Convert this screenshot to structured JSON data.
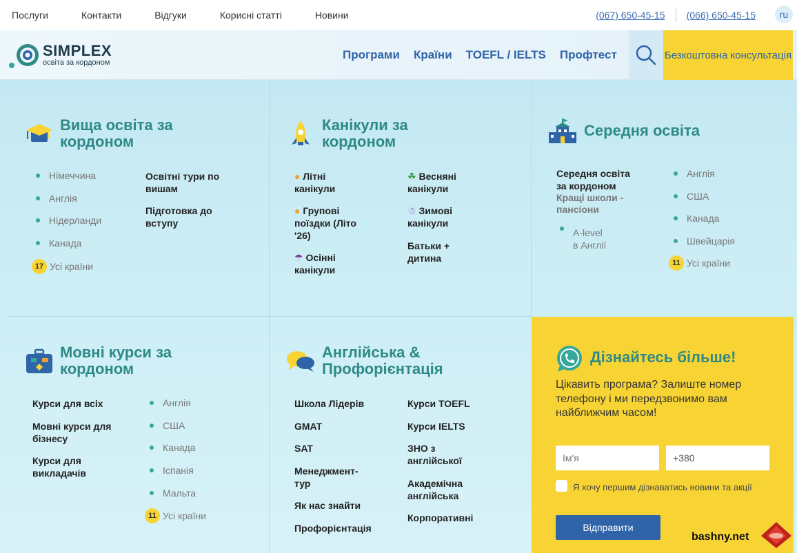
{
  "topbar": {
    "nav": [
      "Послуги",
      "Контакти",
      "Відгуки",
      "Корисні статті",
      "Новини"
    ],
    "phone1": "(067) 650-45-15",
    "phone2": "(066) 650-45-15",
    "lang": "ru"
  },
  "header": {
    "logo_title": "SIMPLEX",
    "logo_sub": "освіта за кордоном",
    "nav": [
      "Програми",
      "Країни",
      "TOEFL / IELTS",
      "Профтест"
    ],
    "consult": "Безкоштовна консультація"
  },
  "higher": {
    "title_line1": "Вища освіта за",
    "title_line2": "кордоном",
    "countries": [
      "Німеччина",
      "Англія",
      "Нідерланди",
      "Канада"
    ],
    "all_count": "17",
    "all_label": "Усі країни",
    "links": [
      {
        "l1": "Освітні тури по",
        "l2": "вишам"
      },
      {
        "l1": "Підготовка до",
        "l2": "вступу"
      }
    ]
  },
  "holidays": {
    "title_line1": "Канікули за",
    "title_line2": "кордоном",
    "left": [
      {
        "icon": "🟠",
        "l1": "Літні",
        "l2": "канікули",
        "l3": ""
      },
      {
        "icon": "🟠",
        "l1": "Групові",
        "l2": "поїздки (Літо",
        "l3": "'26)"
      },
      {
        "icon": "☂",
        "l1": "Осінні",
        "l2": "канікули",
        "l3": ""
      }
    ],
    "right": [
      {
        "icon": "☘",
        "l1": "Весняні",
        "l2": "канікули"
      },
      {
        "icon": "☃",
        "l1": "Зимові",
        "l2": "канікули"
      },
      {
        "icon": "",
        "l1": "Батьки +",
        "l2": "дитина"
      }
    ]
  },
  "secondary": {
    "title": "Середня освіта",
    "main_l1": "Середня освіта",
    "main_l2": "за кордоном",
    "sub_l1": "Кращі школи -",
    "sub_l2": "пансіони",
    "alevel_l1": "A-level",
    "alevel_l2": "в Англії",
    "countries": [
      "Англія",
      "США",
      "Канада",
      "Швейцарія"
    ],
    "all_count": "11",
    "all_label": "Усі країни"
  },
  "language": {
    "title_line1": "Мовні курси за",
    "title_line2": "кордоном",
    "links": [
      {
        "l1": "Курси для всіх",
        "l2": ""
      },
      {
        "l1": "Мовні курси для",
        "l2": "бізнесу"
      },
      {
        "l1": "Курси для",
        "l2": "викладачів"
      }
    ],
    "countries": [
      "Англія",
      "США",
      "Канада",
      "Іспанія",
      "Мальта"
    ],
    "all_count": "11",
    "all_label": "Усі країни"
  },
  "english": {
    "title_line1": "Англійська &",
    "title_line2": "Профорієнтація",
    "left": [
      {
        "l1": "Школа Лідерів",
        "l2": ""
      },
      {
        "l1": "GMAT",
        "l2": ""
      },
      {
        "l1": "SAT",
        "l2": ""
      },
      {
        "l1": "Менеджмент-",
        "l2": "тур"
      },
      {
        "l1": "Як нас знайти",
        "l2": ""
      },
      {
        "l1": "Профорієнтація",
        "l2": ""
      }
    ],
    "right": [
      {
        "l1": "Курси TOEFL",
        "l2": ""
      },
      {
        "l1": "Курси IELTS",
        "l2": ""
      },
      {
        "l1": "ЗНО з",
        "l2": "англійської"
      },
      {
        "l1": "Академічна",
        "l2": "англійська"
      },
      {
        "l1": "Корпоративні",
        "l2": ""
      }
    ]
  },
  "contact": {
    "title": "Дізнайтесь більше!",
    "text": "Цікавить програма? Залиште номер телефону і ми передзвонимо вам найближчим часом!",
    "name_placeholder": "Ім'я",
    "phone_value": "+380",
    "checkbox_label": "Я хочу першим дізнаватись новини та акції",
    "submit": "Відправити"
  },
  "watermark": "bashny.net",
  "colors": {
    "accent_blue": "#2f64a8",
    "teal": "#2e8a87",
    "yellow": "#f7d433"
  }
}
